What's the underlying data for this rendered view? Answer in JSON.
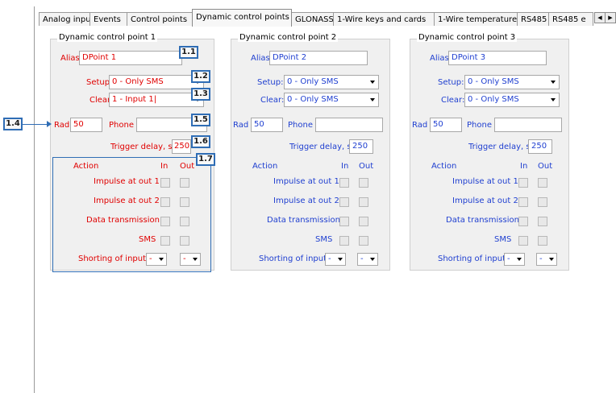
{
  "tabs": [
    "Analog inputs",
    "Events",
    "Control points",
    "Dynamic control points",
    "GLONASS",
    "1-Wire keys and cards",
    "1-Wire temperature",
    "RS485",
    "RS485 e"
  ],
  "active_tab_index": 3,
  "tab_scroll": {
    "left": "◀",
    "right": "▶"
  },
  "groups": [
    {
      "title": "Dynamic control point 1",
      "alias_label": "Alias",
      "alias_value": "DPoint 1",
      "setup_label": "Setup:",
      "setup_value": "0 - Only SMS",
      "clear_label": "Clear:",
      "clear_value": "1 - Input 1",
      "rad_label": "Rad",
      "rad_value": "50",
      "phone_label": "Phone",
      "phone_value": "",
      "trigger_label": "Trigger delay, s",
      "trigger_value": "250",
      "action_header": "Action",
      "in_header": "In",
      "out_header": "Out",
      "actions": [
        "Impulse at out 1",
        "Impulse at out 2",
        "Data transmission",
        "SMS"
      ],
      "shorting_label": "Shorting of input",
      "shorting_in": "-",
      "shorting_out": "-",
      "text_color": "#e00000"
    },
    {
      "title": "Dynamic control point 2",
      "alias_label": "Alias",
      "alias_value": "DPoint 2",
      "setup_label": "Setup:",
      "setup_value": "0 - Only SMS",
      "clear_label": "Clear:",
      "clear_value": "0 - Only SMS",
      "rad_label": "Rad",
      "rad_value": "50",
      "phone_label": "Phone",
      "phone_value": "",
      "trigger_label": "Trigger delay, s",
      "trigger_value": "250",
      "action_header": "Action",
      "in_header": "In",
      "out_header": "Out",
      "actions": [
        "Impulse at out 1",
        "Impulse at out 2",
        "Data transmission",
        "SMS"
      ],
      "shorting_label": "Shorting of input",
      "shorting_in": "-",
      "shorting_out": "-",
      "text_color": "#1f3fd0"
    },
    {
      "title": "Dynamic control point 3",
      "alias_label": "Alias",
      "alias_value": "DPoint 3",
      "setup_label": "Setup:",
      "setup_value": "0 - Only SMS",
      "clear_label": "Clear:",
      "clear_value": "0 - Only SMS",
      "rad_label": "Rad",
      "rad_value": "50",
      "phone_label": "Phone",
      "phone_value": "",
      "trigger_label": "Trigger delay, s",
      "trigger_value": "250",
      "action_header": "Action",
      "in_header": "In",
      "out_header": "Out",
      "actions": [
        "Impulse at out 1",
        "Impulse at out 2",
        "Data transmission",
        "SMS"
      ],
      "shorting_label": "Shorting of input",
      "shorting_in": "-",
      "shorting_out": "-",
      "text_color": "#1f3fd0"
    }
  ],
  "callouts": {
    "c11": "1.1",
    "c12": "1.2",
    "c13": "1.3",
    "c14": "1.4",
    "c15": "1.5",
    "c16": "1.6",
    "c17": "1.7"
  },
  "colors": {
    "red_text": "#e00000",
    "blue_text": "#1f3fd0",
    "callout_border": "#2f6db5"
  }
}
